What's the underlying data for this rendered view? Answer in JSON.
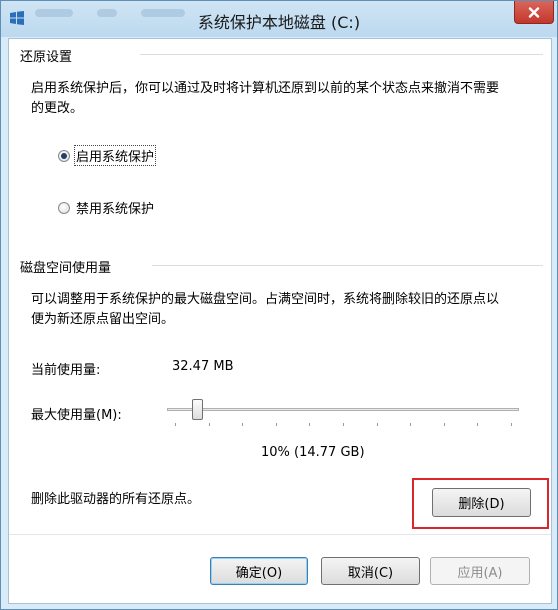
{
  "window": {
    "title": "系统保护本地磁盘 (C:)"
  },
  "restore": {
    "group_title": "还原设置",
    "description_line1": "启用系统保护后，你可以通过及时将计算机还原到以前的某个状态点来撤消不需要",
    "description_line2": "的更改。",
    "options": [
      {
        "label": "启用系统保护",
        "selected": true
      },
      {
        "label": "禁用系统保护",
        "selected": false
      }
    ]
  },
  "disk": {
    "group_title": "磁盘空间使用量",
    "description_line1": "可以调整用于系统保护的最大磁盘空间。占满空间时，系统将删除较旧的还原点以",
    "description_line2": "便为新还原点留出空间。",
    "current_usage_label": "当前使用量:",
    "current_usage_value": "32.47 MB",
    "max_usage_label": "最大使用量(M):",
    "max_usage_value": "10% (14.77 GB)",
    "max_usage_fraction": 0.1
  },
  "delete": {
    "label": "删除此驱动器的所有还原点。",
    "button": "删除(D)"
  },
  "buttons": {
    "ok": "确定(O)",
    "cancel": "取消(C)",
    "apply": "应用(A)"
  },
  "colors": {
    "highlight": "#d9262b",
    "close_button": "#c4372c"
  },
  "icons": {
    "window": "windows-logo-icon",
    "close": "close-icon"
  }
}
